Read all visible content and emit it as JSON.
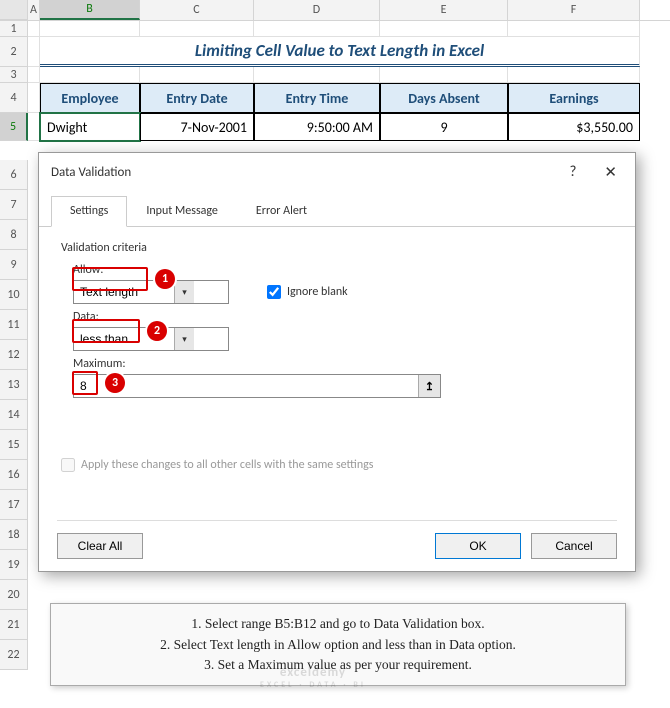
{
  "cols": [
    "A",
    "B",
    "C",
    "D",
    "E",
    "F"
  ],
  "title": "Limiting Cell Value to Text Length in Excel",
  "table": {
    "headers": [
      "Employee",
      "Entry Date",
      "Entry Time",
      "Days Absent",
      "Earnings"
    ],
    "row": {
      "employee": "Dwight",
      "date": "7-Nov-2001",
      "time": "9:50:00 AM",
      "days": "9",
      "earnings": "$3,550.00"
    }
  },
  "dialog": {
    "title": "Data Validation",
    "tabs": [
      "Settings",
      "Input Message",
      "Error Alert"
    ],
    "criteria_label": "Validation criteria",
    "allow_label": "Allow:",
    "allow_value": "Text length",
    "ignore_blank": "Ignore blank",
    "data_label": "Data:",
    "data_value": "less than",
    "max_label": "Maximum:",
    "max_value": "8",
    "apply_label": "Apply these changes to all other cells with the same settings",
    "clear": "Clear All",
    "ok": "OK",
    "cancel": "Cancel",
    "help": "?",
    "close": "✕"
  },
  "badges": {
    "b1": "1",
    "b2": "2",
    "b3": "3"
  },
  "instructions": {
    "l1": "1. Select range B5:B12 and go to Data Validation box.",
    "l2": "2. Select Text length in Allow option and less than in Data option.",
    "l3": "3. Set a Maximum value as per your requirement."
  },
  "watermark": {
    "main": "exceldemy",
    "sub": "EXCEL · DATA · BI"
  }
}
